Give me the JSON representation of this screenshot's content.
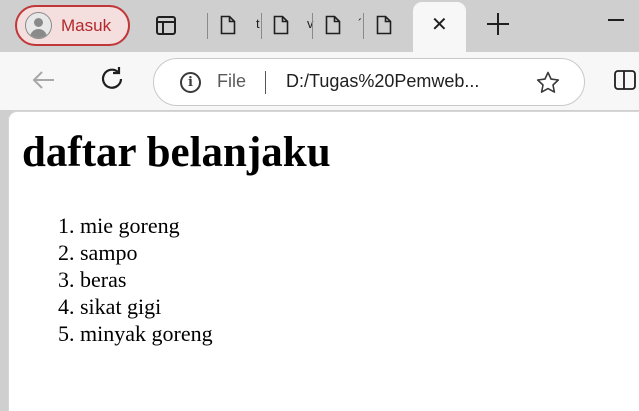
{
  "tabstrip": {
    "profile_label": "Masuk",
    "tab_fragments": [
      "t",
      "v",
      "´"
    ],
    "active_tab_close": "✕"
  },
  "toolbar": {
    "scheme_label": "File",
    "info_glyph": "i",
    "url": "D:/Tugas%20Pemweb..."
  },
  "page": {
    "title": "daftar belanjaku",
    "list": [
      {
        "marker": "1.",
        "text": "mie goreng"
      },
      {
        "marker": "2.",
        "text": "sampo"
      },
      {
        "marker": "3.",
        "text": "beras"
      },
      {
        "marker": "4.",
        "text": "sikat gigi"
      },
      {
        "marker": "5.",
        "text": "minyak goreng"
      }
    ]
  },
  "colors": {
    "profile_accent": "#c0373a",
    "chrome_bg": "#cfcfcf",
    "toolbar_bg": "#f7f7f7"
  },
  "icons": [
    "avatar-icon",
    "workspaces-icon",
    "document-icon",
    "close-icon",
    "plus-icon",
    "minimize-icon",
    "back-arrow-icon",
    "reload-icon",
    "info-icon",
    "star-icon",
    "split-screen-icon"
  ]
}
